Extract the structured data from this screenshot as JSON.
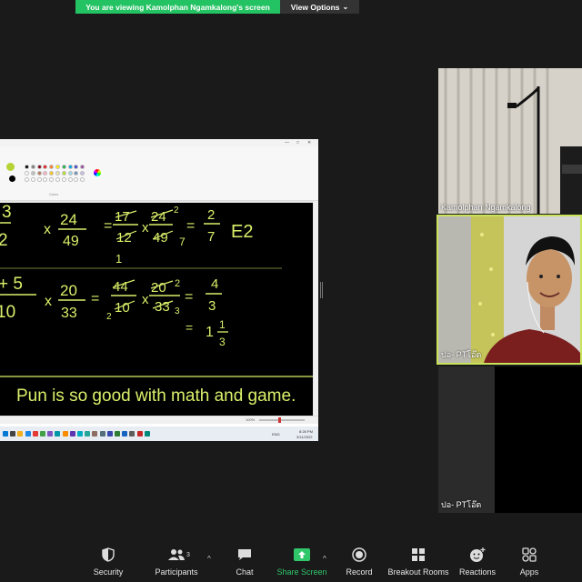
{
  "banner": {
    "viewing_text": "You are viewing Kamolphan Ngamkalong's screen",
    "view_options_label": "View Options",
    "view_options_caret": "⌄"
  },
  "shared_screen": {
    "ribbon_colors_label": "Colors",
    "math": {
      "row1": {
        "frac_a_num": "3",
        "frac_a_den": "2",
        "times1": "x",
        "frac_b_num": "24",
        "frac_b_den": "49",
        "eq1": "=",
        "frac_c_num": "17",
        "frac_c_den": "12",
        "times2": "x",
        "frac_d_num": "24",
        "frac_d_sup": "2",
        "frac_d_den": "49",
        "frac_d_sub": "7",
        "eq2": "=",
        "result_num": "2",
        "result_den": "7",
        "tag": "E2",
        "sub_one": "1"
      },
      "row2": {
        "frac_a_num": "+ 5",
        "frac_a_den": "10",
        "times1": "x",
        "frac_b_num": "20",
        "frac_b_den": "33",
        "eq1": "=",
        "frac_c_num": "44",
        "frac_c_den": "10",
        "frac_c_sub": "2",
        "times2": "x",
        "frac_d_num": "20",
        "frac_d_sup": "2",
        "frac_d_den": "33",
        "frac_d_sub": "3",
        "eq2": "=",
        "result_num": "4",
        "result_den": "3",
        "mixed_eq": "=",
        "mixed_whole": "1",
        "mixed_num": "1",
        "mixed_den": "3"
      },
      "note": "Pun is so good with math and game."
    },
    "status_zoom": "100%",
    "taskbar": {
      "lang": "ENG",
      "time": "8:28 PM",
      "date": "3/11/2022"
    }
  },
  "participants": [
    {
      "name": "Kamolphan Ngamkalong"
    },
    {
      "name": "ปอ- PTโอ๊ต"
    },
    {
      "name": "ปอ- PTโอ๊ต"
    }
  ],
  "toolbar": {
    "security": {
      "label": "Security",
      "icon": "shield-icon"
    },
    "participants": {
      "label": "Participants",
      "count": "3",
      "icon": "people-icon"
    },
    "chat": {
      "label": "Chat",
      "icon": "chat-bubble-icon"
    },
    "share_screen": {
      "label": "Share Screen",
      "icon": "share-screen-icon"
    },
    "record": {
      "label": "Record",
      "icon": "record-icon"
    },
    "breakout_rooms": {
      "label": "Breakout Rooms",
      "icon": "grid-icon"
    },
    "reactions": {
      "label": "Reactions",
      "icon": "smiley-plus-icon"
    },
    "apps": {
      "label": "Apps",
      "icon": "apps-icon"
    },
    "caret": "^"
  },
  "colors": {
    "banner_green": "#23c262",
    "share_green": "#30c66a",
    "chalk": "#d9f06a",
    "active_border": "#c8e35a"
  }
}
